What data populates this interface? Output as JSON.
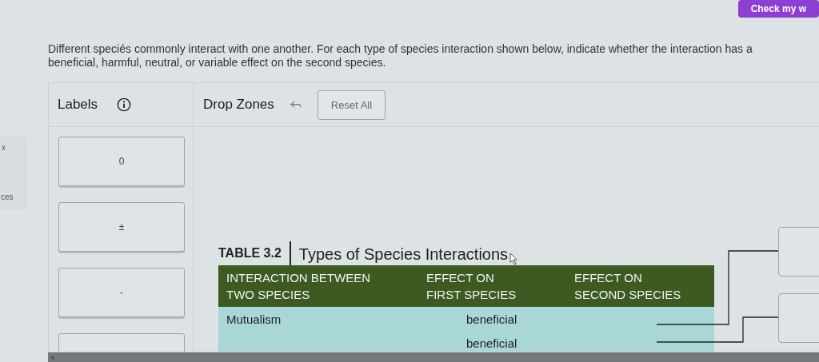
{
  "top_button": {
    "label": "Check my w"
  },
  "side_tab": {
    "labels": [
      "x",
      "ces"
    ]
  },
  "instructions": "Different speciés commonly interact with one another. For each type of species interaction shown below, indicate whether the interaction has a beneficial, harmful, neutral, or variable effect on the second species.",
  "labels_panel": {
    "title": "Labels",
    "cards": [
      {
        "kind": "symbol",
        "label": "0"
      },
      {
        "kind": "symbol",
        "label": "±"
      },
      {
        "kind": "symbol",
        "label": "-"
      },
      {
        "kind": "blank"
      }
    ]
  },
  "drop_panel": {
    "title": "Drop Zones",
    "reset": "Reset All"
  },
  "table": {
    "number": "TABLE 3.2",
    "title": "Types of Species Interactions",
    "columns": [
      [
        "INTERACTION BETWEEN",
        "TWO SPECIES"
      ],
      [
        "EFFECT ON",
        "FIRST SPECIES"
      ],
      [
        "EFFECT ON",
        "SECOND SPECIES"
      ]
    ],
    "rows": [
      {
        "interaction": "Mutualism",
        "first": "beneficial"
      },
      {
        "first": "beneficial"
      }
    ]
  },
  "drop_targets": [
    {
      "kind": "box"
    },
    {
      "kind": "box"
    }
  ]
}
